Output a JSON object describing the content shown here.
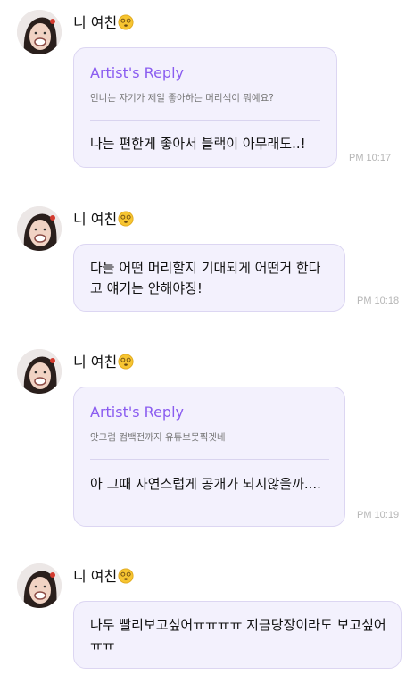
{
  "sender_name": "니 여친",
  "sender_emoji": "face-with-spiral-eyes-icon",
  "colors": {
    "accent": "#8a5cf0",
    "bubble_bg": "#f3f1fd",
    "bubble_border": "#dcd6f2",
    "time": "#b5b5b5"
  },
  "messages": [
    {
      "sender": "니 여친",
      "reply_title": "Artist's Reply",
      "reply_quote": "언니는 자기가 제일 좋아하는 머리색이 뭐예요?",
      "text": "나는 편한게 좋아서 블랙이 아무래도..!",
      "time": "PM 10:17"
    },
    {
      "sender": "니 여친",
      "text": "다들 어떤 머리할지 기대되게 어떤거 한다고 얘기는 안해야징!",
      "time": "PM 10:18"
    },
    {
      "sender": "니 여친",
      "reply_title": "Artist's Reply",
      "reply_quote": "앗그럼 컴백전까지 유튜브못찍겟네",
      "text": "아 그때 자연스럽게 공개가 되지않을까....",
      "time": "PM 10:19"
    },
    {
      "sender": "니 여친",
      "text": "나두 빨리보고싶어ㅠㅠㅠㅠ 지금당장이라도 보고싶어ㅠㅠ"
    }
  ]
}
